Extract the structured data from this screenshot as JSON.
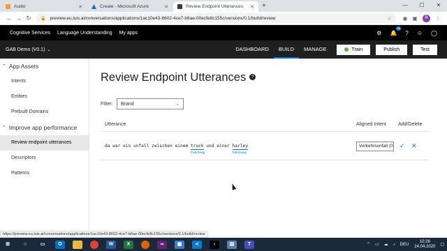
{
  "browser": {
    "tabs": [
      {
        "title": "Audio",
        "favicon_color": "#e8a33d",
        "active": false
      },
      {
        "title": "Create - Microsoft Azure",
        "favicon_color": "#0078d4",
        "active": false
      },
      {
        "title": "Review Endpoint Utterances",
        "favicon_color": "#3a3a3a",
        "active": true
      }
    ],
    "new_tab": "+",
    "url": "preview.eu.luis.ai/conversations/applications/1ac10e43-8602-4ce7-b6ae-00ecfe8c155c/versions/0.1/build/review",
    "profile_initial": "R",
    "status_url": "https://preview.eu.luis.ai/conversations/applications/1ac10e43-8602-4ce7-b6ae-00ecfe8c155c/versions/0.1/build/review"
  },
  "appbar": {
    "links": [
      "Cognitive Services",
      "Language Understanding",
      "My apps"
    ],
    "notification_count": "24"
  },
  "subbar": {
    "app_name": "GAB Demo (V0.1)",
    "nav": [
      "DASHBOARD",
      "BUILD",
      "MANAGE"
    ],
    "active_nav": "BUILD",
    "train_label": "Train",
    "publish_label": "Publish",
    "test_label": "Test"
  },
  "sidebar": {
    "section1": "App Assets",
    "section1_items": [
      "Intents",
      "Entities",
      "Prebuilt Domains"
    ],
    "section2": "Improve app performance",
    "section2_items": [
      "Review endpoint utterances",
      "Descriptors",
      "Patterns"
    ],
    "active_item": "Review endpoint utterances"
  },
  "main": {
    "title": "Review Endpoint Utterances",
    "filter_label": "Filter:",
    "filter_value": "Brand",
    "columns": {
      "utterance": "Utterance",
      "aligned_intent": "Aligned Intent",
      "add_delete": "Add/Delete"
    },
    "utterance": {
      "part1": "da war ein unfall zwischen einem ",
      "entity1": "truck",
      "entity1_label": "Fahrzeug",
      "part2": " und einer ",
      "entity2": "harley",
      "entity2_label": "Fahrzeug"
    },
    "aligned_intent": "Verkehrsunfall (0.",
    "accept_icon": "✓",
    "reject_icon": "✕"
  },
  "taskbar": {
    "language": "DEU",
    "time": "10:26",
    "date": "24.04.2020"
  }
}
